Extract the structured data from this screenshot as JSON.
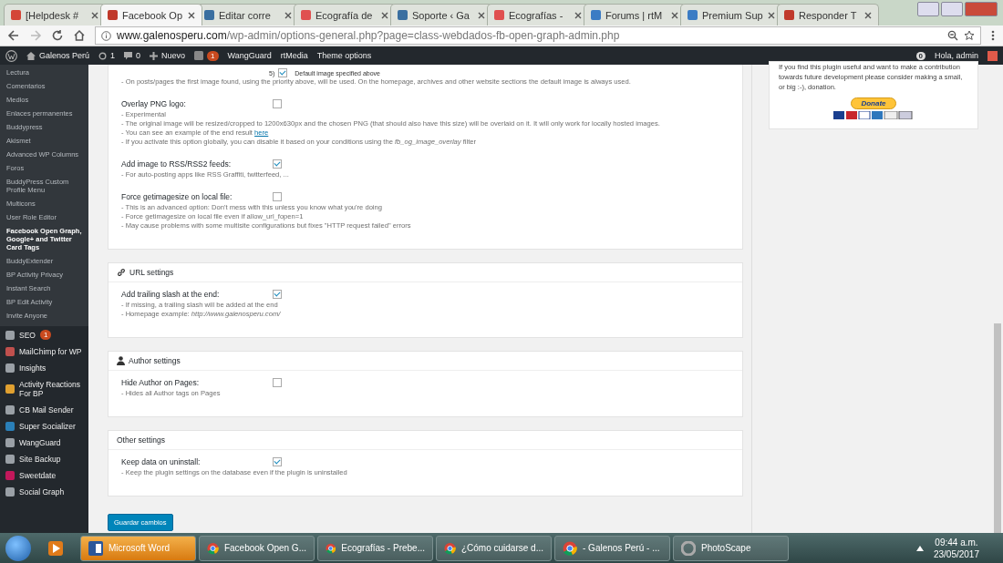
{
  "browser": {
    "tabs": [
      {
        "title": "[Helpdesk #",
        "selected": false,
        "color": "#d44638"
      },
      {
        "title": "Facebook Op",
        "selected": true,
        "color": "#c0392b"
      },
      {
        "title": "Editar corre",
        "selected": false,
        "color": "#3a6fa0"
      },
      {
        "title": "Ecografía de",
        "selected": false,
        "color": "#e05050"
      },
      {
        "title": "Soporte ‹ Ga",
        "selected": false,
        "color": "#3a6fa0"
      },
      {
        "title": "Ecografías -",
        "selected": false,
        "color": "#e05050"
      },
      {
        "title": "Forums | rtM",
        "selected": false,
        "color": "#3b7cc4"
      },
      {
        "title": "Premium Sup",
        "selected": false,
        "color": "#3b7cc4"
      },
      {
        "title": "Responder T",
        "selected": false,
        "color": "#c0392b"
      }
    ],
    "url_host": "www.galenosperu.com",
    "url_path": "/wp-admin/options-general.php?page=class-webdados-fb-open-graph-admin.php"
  },
  "admin_bar": {
    "site": "Galenos Perú",
    "updates": "1",
    "comments": "0",
    "new": "Nuevo",
    "seo_badge": "1",
    "links": [
      "WangGuard",
      "rtMedia",
      "Theme options"
    ],
    "notifications": "0",
    "greeting": "Hola, admin"
  },
  "sidebar": {
    "submenu": [
      {
        "label": "Lectura",
        "selected": false
      },
      {
        "label": "Comentarios",
        "selected": false
      },
      {
        "label": "Medios",
        "selected": false
      },
      {
        "label": "Enlaces permanentes",
        "selected": false
      },
      {
        "label": "Buddypress",
        "selected": false
      },
      {
        "label": "Akismet",
        "selected": false
      },
      {
        "label": "Advanced WP Columns",
        "selected": false
      },
      {
        "label": "Foros",
        "selected": false
      },
      {
        "label": "BuddyPress Custom Profile Menu",
        "selected": false
      },
      {
        "label": "Multicons",
        "selected": false
      },
      {
        "label": "User Role Editor",
        "selected": false
      },
      {
        "label": "Facebook Open Graph, Google+ and Twitter Card Tags",
        "selected": true
      },
      {
        "label": "BuddyExtender",
        "selected": false
      },
      {
        "label": "BP Activity Privacy",
        "selected": false
      },
      {
        "label": "Instant Search",
        "selected": false
      },
      {
        "label": "BP Edit Activity",
        "selected": false
      },
      {
        "label": "Invite Anyone",
        "selected": false
      }
    ],
    "menu": [
      {
        "label": "SEO",
        "badge": "1",
        "color": "#9aa0a6"
      },
      {
        "label": "MailChimp for WP",
        "color": "#c0504d"
      },
      {
        "label": "Insights",
        "color": "#9aa0a6"
      },
      {
        "label": "Activity Reactions For BP",
        "color": "#e0a030"
      },
      {
        "label": "CB Mail Sender",
        "color": "#9aa0a6"
      },
      {
        "label": "Super Socializer",
        "color": "#2a7fb8"
      },
      {
        "label": "WangGuard",
        "color": "#9aa0a6"
      },
      {
        "label": "Site Backup",
        "color": "#9aa0a6"
      },
      {
        "label": "Sweetdate",
        "color": "#c2185b"
      },
      {
        "label": "Social Graph",
        "color": "#9aa0a6"
      }
    ]
  },
  "sections": [
    {
      "default_image": {
        "number": "5)",
        "label": "Default image specified above",
        "checked": true
      },
      "intro": "- On posts/pages the first image found, using the priority above, will be used. On the homepage, archives and other website sections the default image is always used.",
      "options": [
        {
          "label": "Overlay PNG logo:",
          "checked": false,
          "lines": [
            {
              "text": "- Experimental"
            },
            {
              "text": "- The original image will be resized/cropped to 1200x630px and the chosen PNG (that should also have this size) will be overlaid on it. It will only work for locally hosted images."
            },
            {
              "text": "- You can see an example of the end result",
              "link": "here"
            },
            {
              "text": "- If you activate this option globally, you can disable it based on your conditions using the *fb_og_image_overlay* filter"
            }
          ]
        },
        {
          "label": "Add image to RSS/RSS2 feeds:",
          "checked": true,
          "lines": [
            {
              "text": "- For auto-posting apps like RSS Graffiti, twitterfeed, ..."
            }
          ]
        },
        {
          "label": "Force getimagesize on local file:",
          "checked": false,
          "lines": [
            {
              "text": "- This is an advanced option: Don't mess with this unless you know what you're doing"
            },
            {
              "text": "- Force getimagesize on local file even if allow_url_fopen=1"
            },
            {
              "text": "- May cause problems with some multisite configurations but fixes \"HTTP request failed\" errors"
            }
          ]
        }
      ]
    },
    {
      "title": "URL settings",
      "options": [
        {
          "label": "Add trailing slash at the end:",
          "checked": true,
          "lines": [
            {
              "text": "- If missing, a trailing slash will be added at the end"
            },
            {
              "text": "- Homepage example: *http://www.galenosperu.com/*"
            }
          ]
        }
      ]
    },
    {
      "title": "Author settings",
      "options": [
        {
          "label": "Hide Author on Pages:",
          "checked": false,
          "lines": [
            {
              "text": "- Hides all Author tags on Pages"
            }
          ]
        }
      ]
    },
    {
      "title": "Other settings",
      "options": [
        {
          "label": "Keep data on uninstall:",
          "checked": true,
          "lines": [
            {
              "text": "- Keep the plugin settings on the database even if the plugin is uninstalled"
            }
          ]
        }
      ]
    }
  ],
  "save_button": "Guardar cambios",
  "donate_panel": {
    "text": "If you find this plugin useful and want to make a contribution towards future development please consider making a small, or big :-), donation.",
    "button": "Donate"
  },
  "taskbar": {
    "items": [
      {
        "label": "Microsoft Word",
        "attention": true,
        "kind": "word"
      },
      {
        "label": "Facebook Open G...",
        "attention": false,
        "kind": "chrome"
      },
      {
        "label": "Ecografías - Prebe...",
        "attention": false,
        "kind": "chrome"
      },
      {
        "label": "¿Cómo cuidarse d...",
        "attention": false,
        "kind": "chrome"
      },
      {
        "label": "- Galenos Perú - ...",
        "attention": false,
        "kind": "chrome"
      },
      {
        "label": "PhotoScape",
        "attention": false,
        "kind": "photoscape"
      }
    ],
    "time": "09:44 a.m.",
    "date": "23/05/2017"
  }
}
